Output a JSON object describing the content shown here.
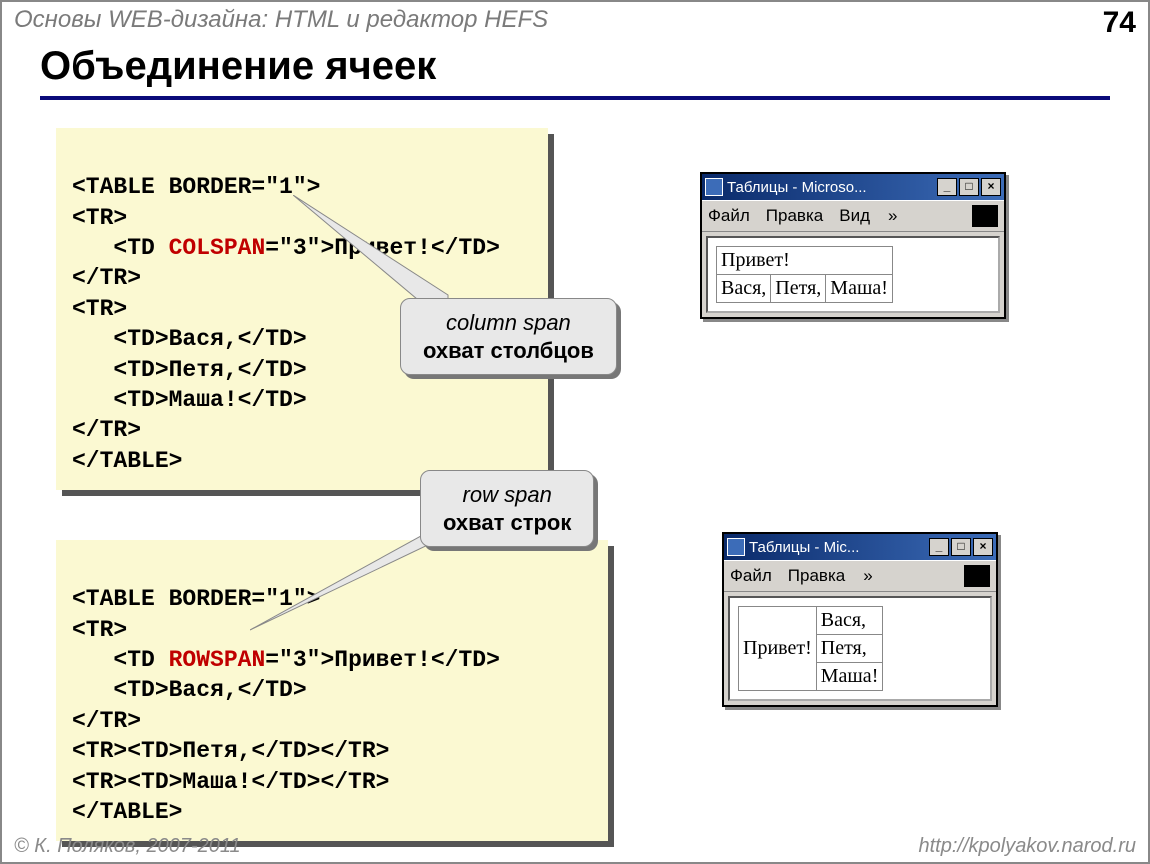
{
  "header": {
    "course": "Основы WEB-дизайна: HTML и редактор HEFS",
    "page": "74"
  },
  "title": "Объединение ячеек",
  "code1": {
    "l1": "<TABLE BORDER=\"1\">",
    "l2": "<TR>",
    "l3a": "   <TD ",
    "l3b": "COLSPAN",
    "l3c": "=\"3\">Привет!</TD>",
    "l4": "</TR>",
    "l5": "<TR>",
    "l6": "   <TD>Вася,</TD>",
    "l7": "   <TD>Петя,</TD>",
    "l8": "   <TD>Маша!</TD>",
    "l9": "</TR>",
    "l10": "</TABLE>"
  },
  "code2": {
    "l1": "<TABLE BORDER=\"1\">",
    "l2": "<TR>",
    "l3a": "   <TD ",
    "l3b": "ROWSPAN",
    "l3c": "=\"3\">Привет!</TD>",
    "l4": "   <TD>Вася,</TD>",
    "l5": "</TR>",
    "l6": "<TR><TD>Петя,</TD></TR>",
    "l7": "<TR><TD>Маша!</TD></TR>",
    "l8": "</TABLE>"
  },
  "callout1": {
    "line1": "column span",
    "line2": "охват столбцов"
  },
  "callout2": {
    "line1": "row span",
    "line2": "охват строк"
  },
  "win1": {
    "title": "Таблицы - Microso...",
    "menu": {
      "file": "Файл",
      "edit": "Правка",
      "view": "Вид",
      "chev": "»"
    },
    "table": {
      "r1c1": "Привет!",
      "r2c1": "Вася,",
      "r2c2": "Петя,",
      "r2c3": "Маша!"
    }
  },
  "win2": {
    "title": "Таблицы - Mic...",
    "menu": {
      "file": "Файл",
      "edit": "Правка",
      "chev": "»"
    },
    "table": {
      "c1": "Привет!",
      "r1": "Вася,",
      "r2": "Петя,",
      "r3": "Маша!"
    }
  },
  "footer": {
    "copy": "© К. Поляков, 2007-2011",
    "url": "http://kpolyakov.narod.ru"
  }
}
